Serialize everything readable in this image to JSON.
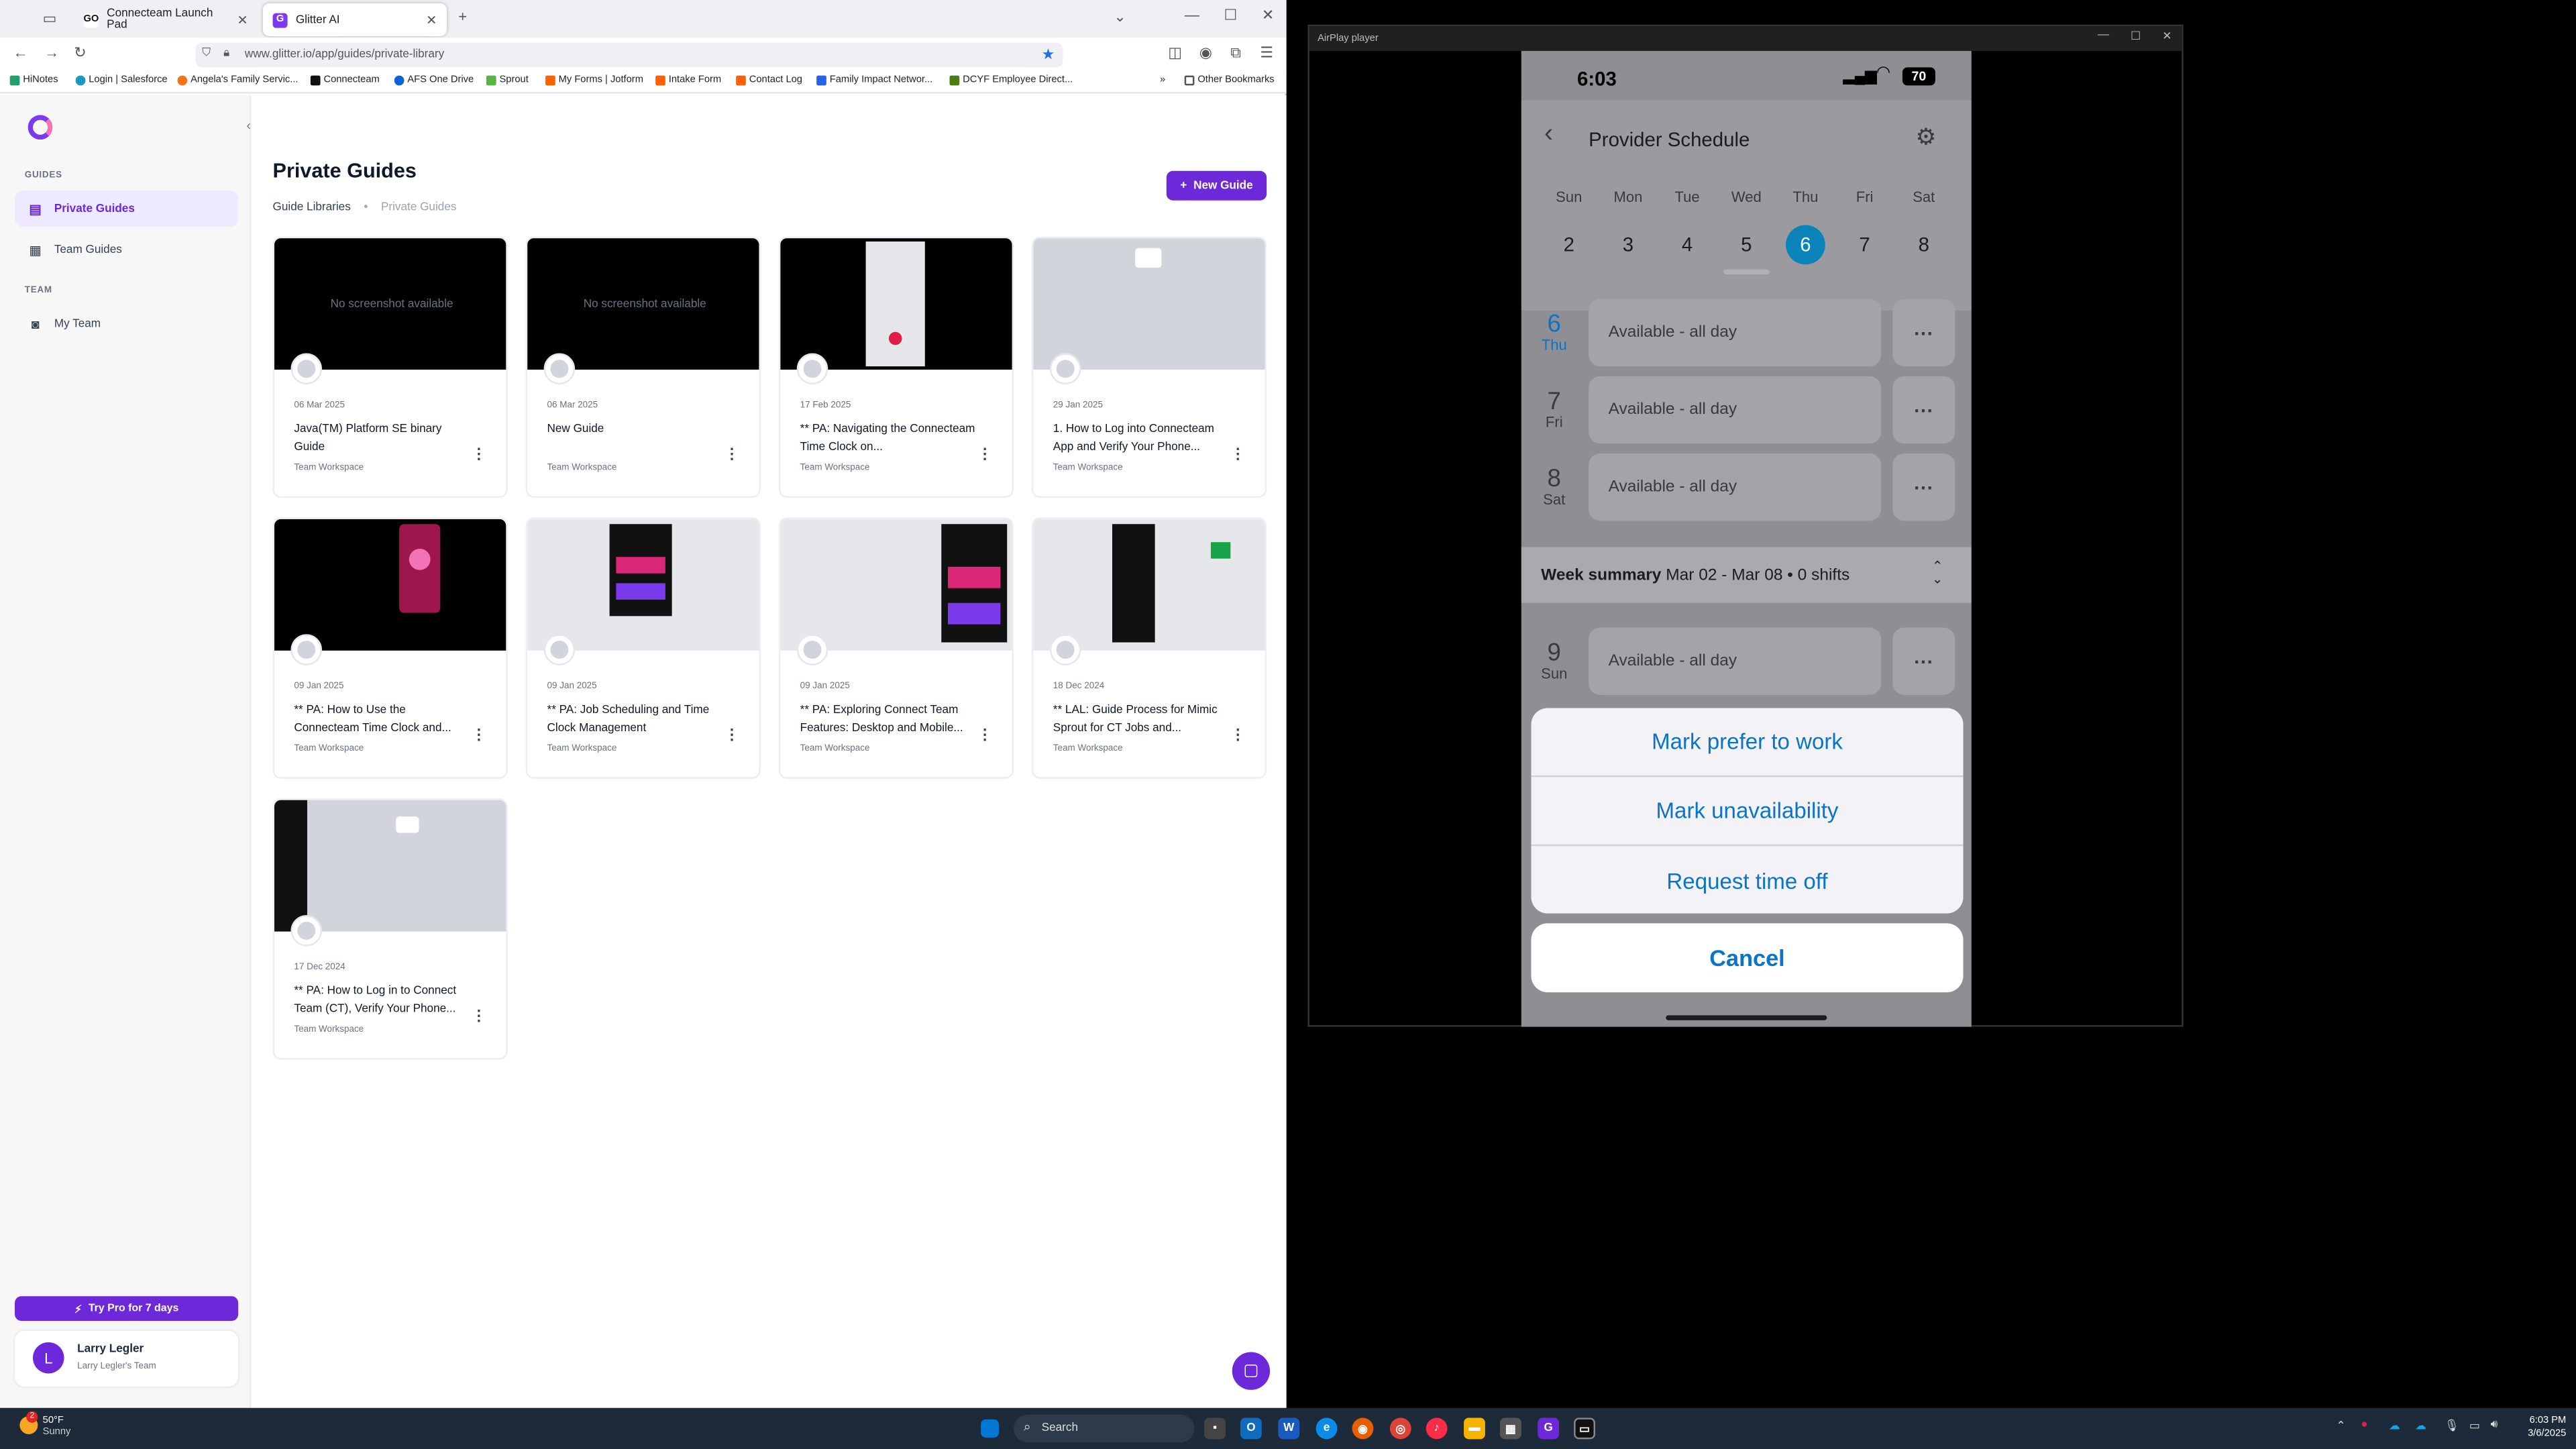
{
  "browser": {
    "tabs": [
      {
        "label": "Connecteam Launch Pad"
      },
      {
        "label": "Glitter AI"
      }
    ],
    "url": "www.glitter.io/app/guides/private-library",
    "bookmarks": [
      "HiNotes",
      "Login | Salesforce",
      "Angela's Family Servic...",
      "Connecteam",
      "AFS One Drive",
      "Sprout",
      "My Forms | Jotform",
      "Intake Form",
      "Contact Log",
      "Family Impact Networ...",
      "DCYF Employee Direct..."
    ],
    "other_bookmarks": "Other Bookmarks"
  },
  "sidebar": {
    "guides_heading": "GUIDES",
    "items": [
      {
        "label": "Private Guides",
        "icon": "document-icon"
      },
      {
        "label": "Team Guides",
        "icon": "stack-icon"
      }
    ],
    "team_heading": "TEAM",
    "team_item": "My Team",
    "try_pro": "Try Pro for 7 days",
    "user": {
      "initial": "L",
      "name": "Larry Legler",
      "team": "Larry Legler's Team"
    }
  },
  "main": {
    "title": "Private Guides",
    "breadcrumb": [
      "Guide Libraries",
      "Private Guides"
    ],
    "new_guide": "New Guide",
    "no_screenshot": "No screenshot available",
    "guides": [
      {
        "date": "06 Mar 2025",
        "title": "Java(TM) Platform SE binary Guide",
        "workspace": "Team Workspace"
      },
      {
        "date": "06 Mar 2025",
        "title": "New Guide",
        "workspace": "Team Workspace"
      },
      {
        "date": "17 Feb 2025",
        "title": "** PA: Navigating the Connecteam Time Clock on...",
        "workspace": "Team Workspace"
      },
      {
        "date": "29 Jan 2025",
        "title": "1. How to Log into Connecteam App and Verify Your Phone...",
        "workspace": "Team Workspace"
      },
      {
        "date": "09 Jan 2025",
        "title": "** PA: How to Use the Connecteam Time Clock and...",
        "workspace": "Team Workspace"
      },
      {
        "date": "09 Jan 2025",
        "title": "** PA: Job Scheduling and Time Clock Management",
        "workspace": "Team Workspace"
      },
      {
        "date": "09 Jan 2025",
        "title": "** PA: Exploring Connect Team Features: Desktop and Mobile...",
        "workspace": "Team Workspace"
      },
      {
        "date": "18 Dec 2024",
        "title": "** LAL: Guide Process for Mimic Sprout for CT Jobs and...",
        "workspace": "Team Workspace"
      },
      {
        "date": "17 Dec 2024",
        "title": "** PA: How to Log in to Connect Team (CT), Verify Your Phone...",
        "workspace": "Team Workspace"
      }
    ]
  },
  "airplay": {
    "window_title": "AirPlay player",
    "phone": {
      "time": "6:03",
      "battery": "70",
      "screen_title": "Provider Schedule",
      "weekdays": [
        "Sun",
        "Mon",
        "Tue",
        "Wed",
        "Thu",
        "Fri",
        "Sat"
      ],
      "dates": [
        "2",
        "3",
        "4",
        "5",
        "6",
        "7",
        "8"
      ],
      "rows": [
        {
          "num": "6",
          "day": "Thu",
          "status": "Available -  all day"
        },
        {
          "num": "7",
          "day": "Fri",
          "status": "Available -  all day"
        },
        {
          "num": "8",
          "day": "Sat",
          "status": "Available -  all day"
        },
        {
          "num": "9",
          "day": "Sun",
          "status": "Available -  all day"
        }
      ],
      "week_summary_label": "Week summary",
      "week_summary_range": "Mar 02 - Mar 08",
      "week_summary_shifts": "• 0 shifts",
      "actions": [
        "Mark prefer to work",
        "Mark unavailability",
        "Request time off"
      ],
      "cancel": "Cancel"
    }
  },
  "taskbar": {
    "temp": "50°F",
    "condition": "Sunny",
    "weather_badge": "2",
    "search": "Search",
    "time": "6:03 PM",
    "date": "3/6/2025"
  }
}
